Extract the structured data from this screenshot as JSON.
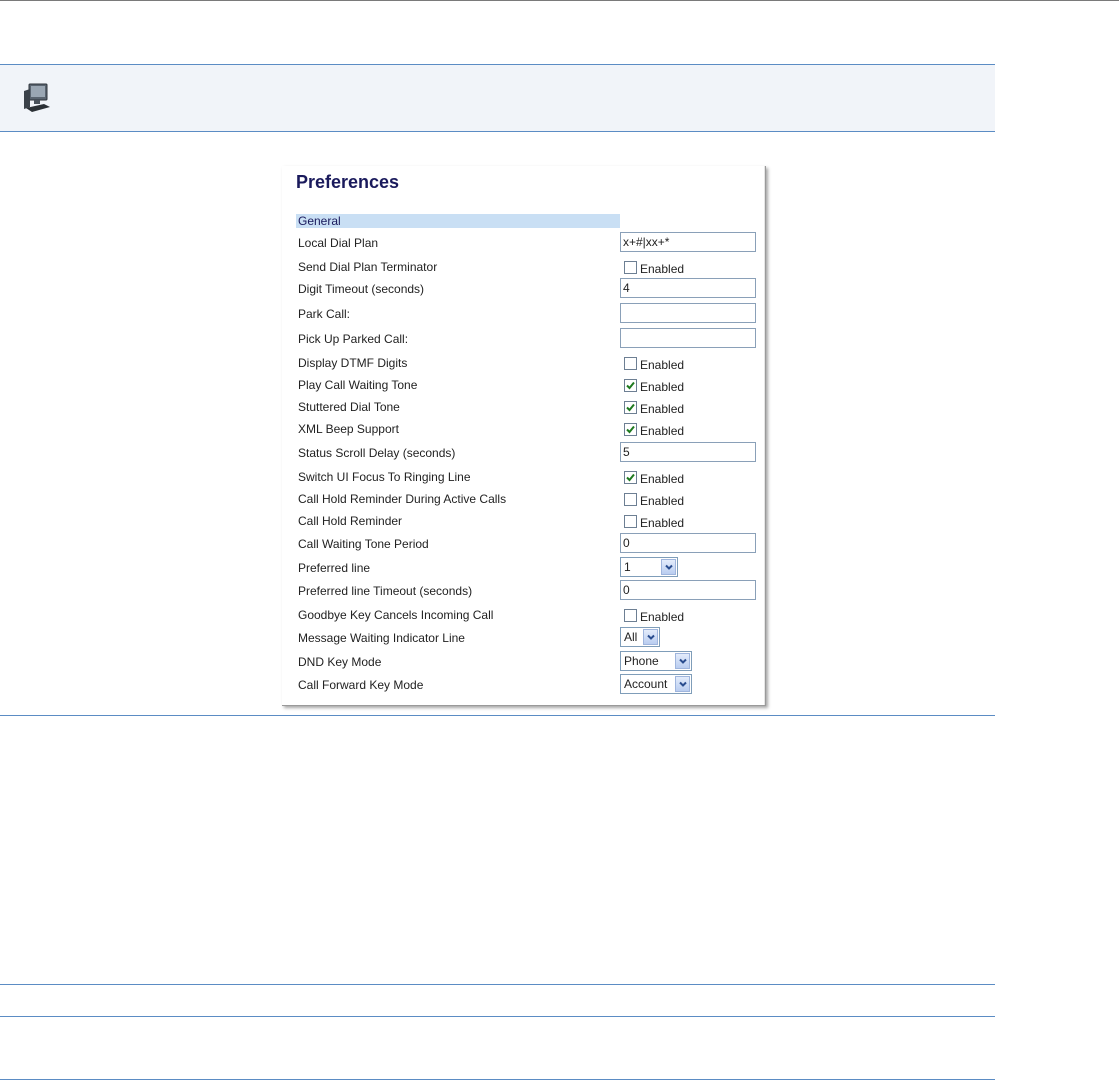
{
  "page": {
    "title": "Preferences",
    "section": "General"
  },
  "icons": {
    "band_icon": "computer-monitor-icon"
  },
  "colors": {
    "rule": "#5b8cc4",
    "band_bg": "#f1f4f9",
    "section_bg": "#c9dff4",
    "title": "#1a1a5c",
    "check": "#1f7a1f"
  },
  "checkbox_text": "Enabled",
  "settings": [
    {
      "label": "Local Dial Plan",
      "type": "text",
      "value": "x+#|xx+*"
    },
    {
      "label": "Send Dial Plan Terminator",
      "type": "checkbox",
      "checked": false
    },
    {
      "label": "Digit Timeout (seconds)",
      "type": "text",
      "value": "4"
    },
    {
      "label": "Park Call:",
      "type": "text",
      "value": ""
    },
    {
      "label": "Pick Up Parked Call:",
      "type": "text",
      "value": ""
    },
    {
      "label": "Display DTMF Digits",
      "type": "checkbox",
      "checked": false
    },
    {
      "label": "Play Call Waiting Tone",
      "type": "checkbox",
      "checked": true
    },
    {
      "label": "Stuttered Dial Tone",
      "type": "checkbox",
      "checked": true
    },
    {
      "label": "XML Beep Support",
      "type": "checkbox",
      "checked": true
    },
    {
      "label": "Status Scroll Delay (seconds)",
      "type": "text",
      "value": "5"
    },
    {
      "label": "Switch UI Focus To Ringing Line",
      "type": "checkbox",
      "checked": true
    },
    {
      "label": "Call Hold Reminder During Active Calls",
      "type": "checkbox",
      "checked": false
    },
    {
      "label": "Call Hold Reminder",
      "type": "checkbox",
      "checked": false
    },
    {
      "label": "Call Waiting Tone Period",
      "type": "text",
      "value": "0"
    },
    {
      "label": "Preferred line",
      "type": "select",
      "value": "1"
    },
    {
      "label": "Preferred line Timeout (seconds)",
      "type": "text",
      "value": "0"
    },
    {
      "label": "Goodbye Key Cancels Incoming Call",
      "type": "checkbox",
      "checked": false
    },
    {
      "label": "Message Waiting Indicator Line",
      "type": "select",
      "value": "All"
    },
    {
      "label": "DND Key Mode",
      "type": "select",
      "value": "Phone"
    },
    {
      "label": "Call Forward Key Mode",
      "type": "select",
      "value": "Account"
    }
  ]
}
